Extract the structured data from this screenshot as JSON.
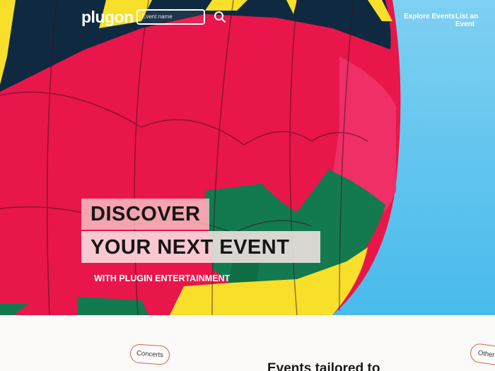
{
  "nav": {
    "logo": "plugon",
    "search_placeholder": "Event name",
    "links": [
      "Explore Events",
      "List an Event"
    ]
  },
  "hero": {
    "headline_line1": "DISCOVER",
    "headline_line2": "YOUR NEXT EVENT",
    "subheadline": "WITH PLUGIN ENTERTAINMENT"
  },
  "categories": {
    "chips": [
      "Concerts",
      "Others"
    ]
  },
  "section": {
    "heading_partial": "Events tailored to"
  },
  "colors": {
    "sky": "#5ec3ee",
    "chip_border": "#e25a48",
    "balloon_red": "#e8164a",
    "balloon_navy": "#112a3e",
    "balloon_yellow": "#f7df2a",
    "balloon_green": "#137a4f"
  },
  "icons": [
    "search-icon"
  ]
}
